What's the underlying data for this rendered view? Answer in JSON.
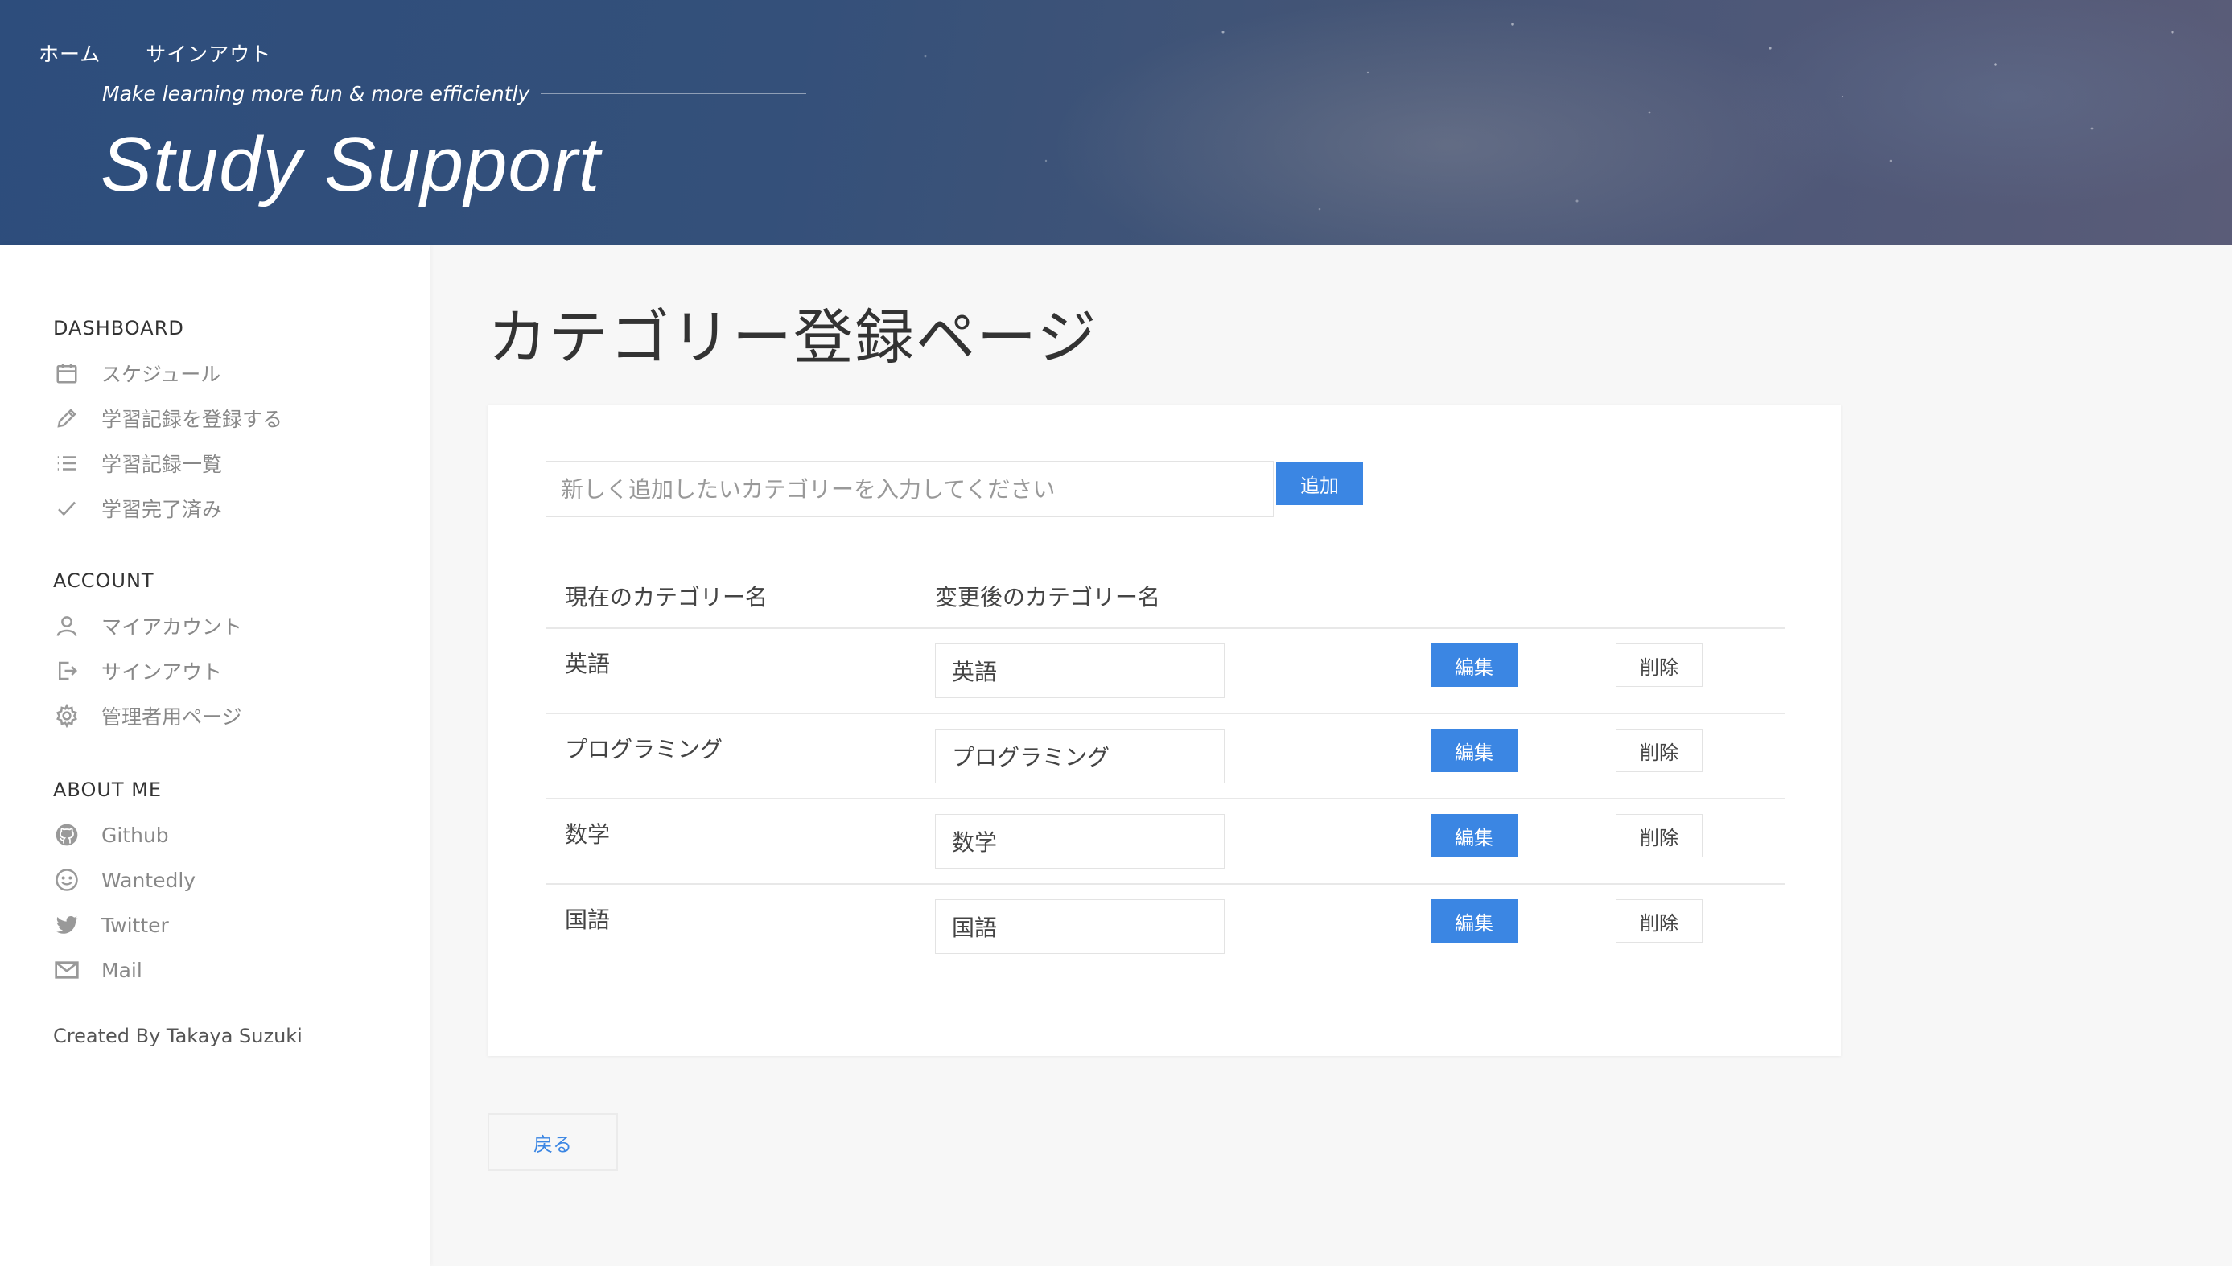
{
  "header": {
    "nav": [
      "ホーム",
      "サインアウト"
    ],
    "tagline": "Make learning more fun & more efficiently",
    "title": "Study Support"
  },
  "sidebar": {
    "sections": [
      {
        "heading": "DASHBOARD",
        "items": [
          {
            "label": "スケジュール",
            "icon": "calendar-icon"
          },
          {
            "label": "学習記録を登録する",
            "icon": "pencil-icon"
          },
          {
            "label": "学習記録一覧",
            "icon": "list-icon"
          },
          {
            "label": "学習完了済み",
            "icon": "check-icon"
          }
        ]
      },
      {
        "heading": "ACCOUNT",
        "items": [
          {
            "label": "マイアカウント",
            "icon": "user-icon"
          },
          {
            "label": "サインアウト",
            "icon": "sign-out-icon"
          },
          {
            "label": "管理者用ページ",
            "icon": "gear-icon"
          }
        ]
      },
      {
        "heading": "ABOUT ME",
        "items": [
          {
            "label": "Github",
            "icon": "github-icon"
          },
          {
            "label": "Wantedly",
            "icon": "smile-icon"
          },
          {
            "label": "Twitter",
            "icon": "twitter-icon"
          },
          {
            "label": "Mail",
            "icon": "mail-icon"
          }
        ]
      }
    ],
    "created_by": "Created By Takaya Suzuki"
  },
  "main": {
    "page_title": "カテゴリー登録ページ",
    "add": {
      "placeholder": "新しく追加したいカテゴリーを入力してください",
      "button_label": "追加"
    },
    "table": {
      "headers": [
        "現在のカテゴリー名",
        "変更後のカテゴリー名"
      ],
      "rows": [
        {
          "current": "英語",
          "new_value": "英語",
          "edit_label": "編集",
          "delete_label": "削除"
        },
        {
          "current": "プログラミング",
          "new_value": "プログラミング",
          "edit_label": "編集",
          "delete_label": "削除"
        },
        {
          "current": "数学",
          "new_value": "数学",
          "edit_label": "編集",
          "delete_label": "削除"
        },
        {
          "current": "国語",
          "new_value": "国語",
          "edit_label": "編集",
          "delete_label": "削除"
        }
      ]
    },
    "back_label": "戻る"
  },
  "colors": {
    "accent": "#3b86e3",
    "header_bg": "#2d4d7c",
    "sidebar_bg": "#ffffff",
    "page_bg": "#f7f7f7"
  }
}
